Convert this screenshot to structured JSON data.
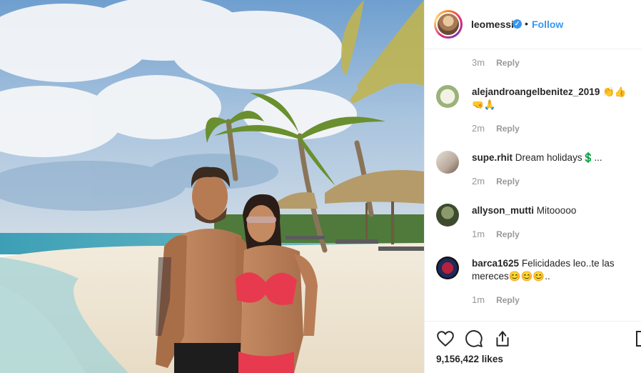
{
  "post": {
    "username": "leomessi",
    "verified_icon": "✓",
    "separator": "•",
    "follow_label": "Follow",
    "more_icon": "more-options-icon"
  },
  "comments": [
    {
      "username": "",
      "text": "",
      "time": "3m",
      "reply": "Reply"
    },
    {
      "username": "alejandroangelbenitez_2019",
      "text": "👏👍🤜🙏",
      "time": "2m",
      "reply": "Reply"
    },
    {
      "username": "supe.rhit",
      "text": "Dream holidays💲...",
      "time": "2m",
      "reply": "Reply"
    },
    {
      "username": "allyson_mutti",
      "text": "Mitooooo",
      "time": "1m",
      "reply": "Reply"
    },
    {
      "username": "barca1625",
      "text": "Felicidades leo..te las mereces😊😊😊..",
      "time": "1m",
      "reply": "Reply"
    }
  ],
  "actions": {
    "like_icon": "heart-icon",
    "comment_icon": "comment-icon",
    "share_icon": "share-icon",
    "save_icon": "bookmark-icon",
    "likes": "9,156,422 likes"
  },
  "colors": {
    "link": "#3897f0",
    "muted": "#999999",
    "text": "#262626"
  }
}
